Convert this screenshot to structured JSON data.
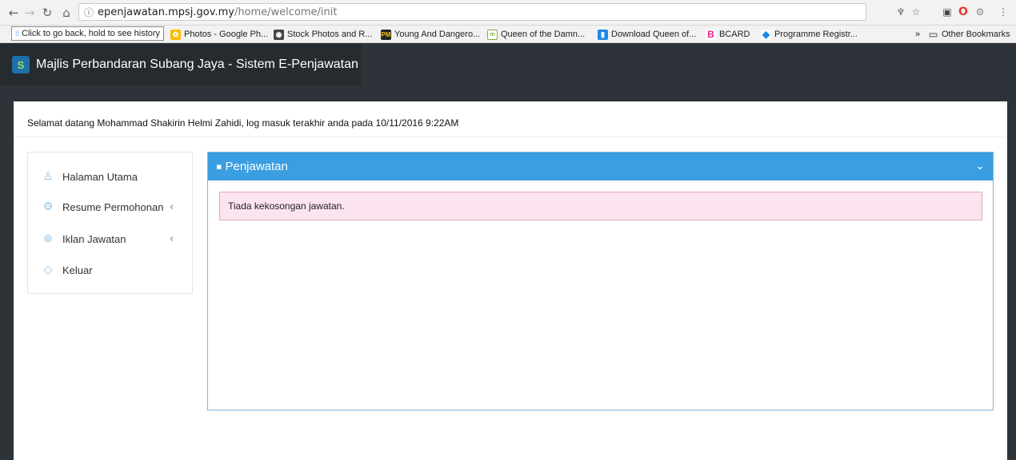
{
  "browser": {
    "url_host": "epenjawatan.mpsj.gov.my",
    "url_path": "/home/welcome/init",
    "tooltip": "Click to go back, hold to see history",
    "bookmarks": [
      {
        "label": "Photos - Google Ph...",
        "color": "#fbbc04"
      },
      {
        "label": "Stock Photos and R...",
        "color": "#444444"
      },
      {
        "label": "Young And Dangero...",
        "color": "#222222"
      },
      {
        "label": "Queen of the Damn...",
        "color": "#7bb342"
      },
      {
        "label": "Download Queen of...",
        "color": "#1e88e5"
      },
      {
        "label": "BCARD",
        "color": "#e91e8c"
      },
      {
        "label": "Programme Registr...",
        "color": "#1e88e5"
      }
    ],
    "other_bookmarks": "Other Bookmarks",
    "overflow": "»"
  },
  "app": {
    "logo_text": "S",
    "title": "Majlis Perbandaran Subang Jaya - Sistem E-Penjawatan"
  },
  "welcome": "Selamat datang Mohammad Shakirin Helmi Zahidi, log masuk terakhir anda pada 10/11/2016 9:22AM",
  "sidebar": {
    "items": [
      {
        "label": "Halaman Utama",
        "icon": "user-icon"
      },
      {
        "label": "Resume Permohonan",
        "icon": "gear-icon",
        "has_children": true
      },
      {
        "label": "Iklan Jawatan",
        "icon": "globe-icon",
        "has_children": true
      },
      {
        "label": "Keluar",
        "icon": "diamond-icon"
      }
    ]
  },
  "panel": {
    "title": "Penjawatan",
    "alert": "Tiada kekosongan jawatan."
  },
  "colors": {
    "accent": "#3a9ee0",
    "header_bg": "#2d3338",
    "alert_bg": "#fbe4ef"
  }
}
